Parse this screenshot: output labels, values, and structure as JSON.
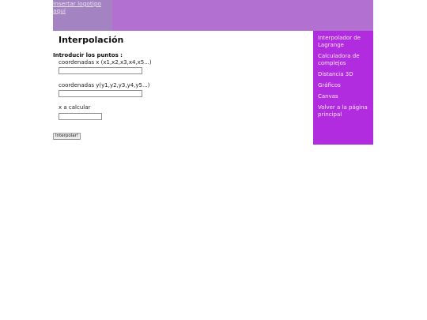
{
  "header": {
    "logo_alt": "Insertar logotipo aquí",
    "logo_line1": "Insertar logotipo",
    "logo_line2": "aquí"
  },
  "main": {
    "title": "Interpolación",
    "form_heading": "Introducir los puntos :",
    "fields": [
      {
        "label": "coordenadas x (x1,x2,x3,x4,x5...)",
        "value": ""
      },
      {
        "label": "coordenadas y(y1,y2,y3,y4,y5...)",
        "value": ""
      },
      {
        "label": "x a calcular",
        "value": ""
      }
    ],
    "submit_label": "Interpolar!"
  },
  "sidebar": {
    "items": [
      {
        "label": "Interpolador de Lagrange"
      },
      {
        "label": "Calculadora de complejos"
      },
      {
        "label": "Distancia 3D"
      },
      {
        "label": "Gráficos"
      },
      {
        "label": "Canvas"
      },
      {
        "label": "Volver a la página principal"
      }
    ]
  },
  "colors": {
    "header_bg": "#b271d0",
    "logo_bg": "#a483c2",
    "sidebar_bg": "#b12bdf",
    "sidebar_text": "#f5e6fb"
  }
}
